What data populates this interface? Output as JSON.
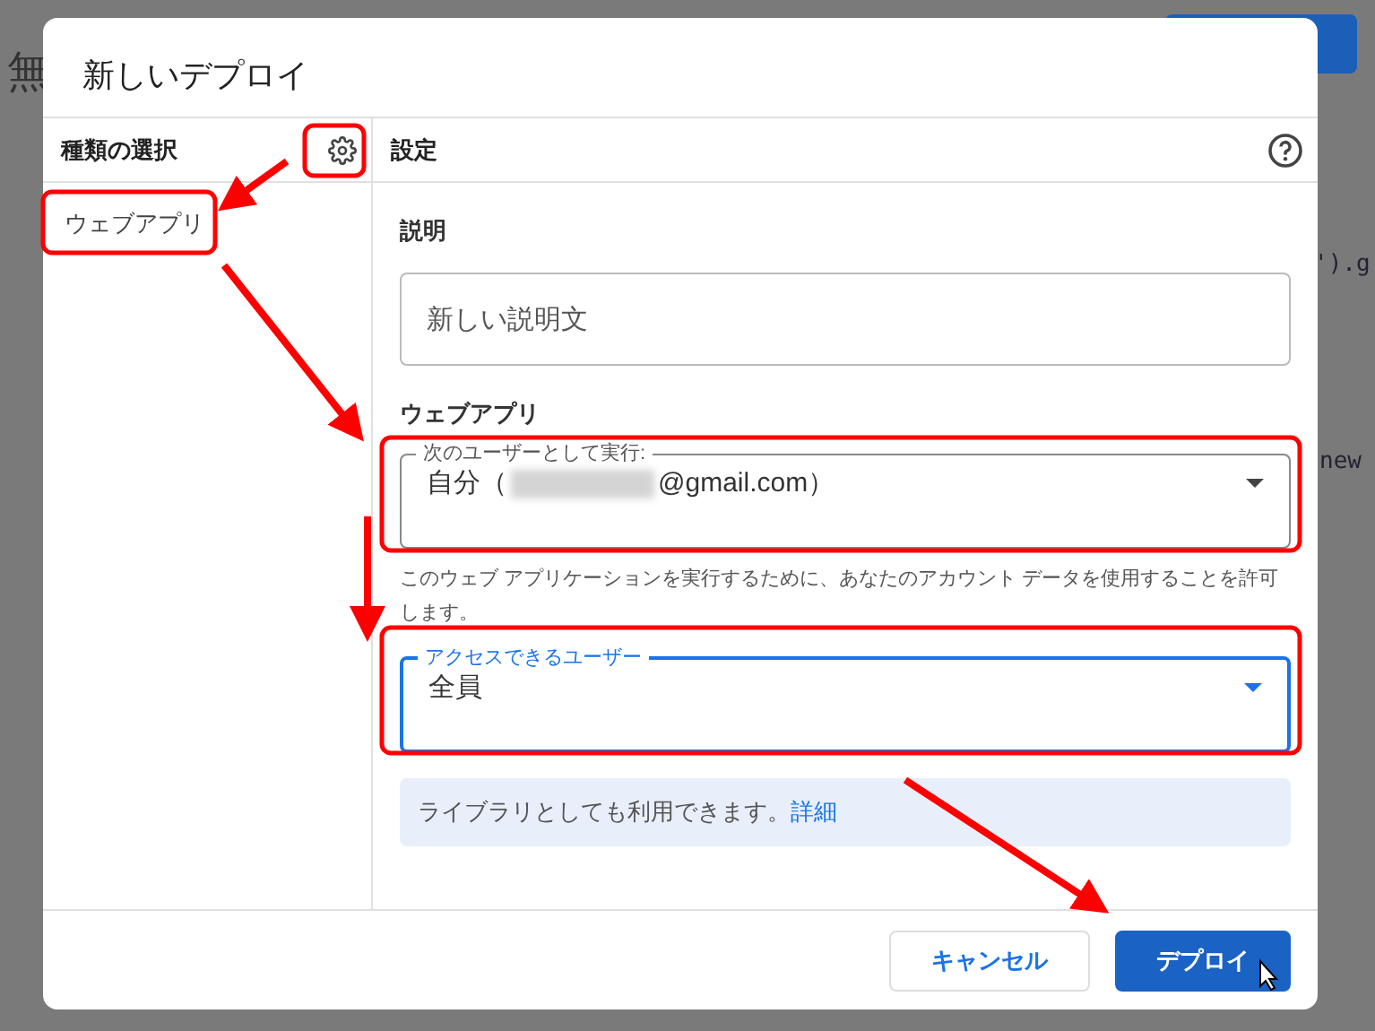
{
  "background": {
    "title": "無",
    "code_lines": [
      "').g",
      "new"
    ]
  },
  "dialog": {
    "title": "新しいデプロイ",
    "sidebar": {
      "heading": "種類の選択",
      "items": [
        {
          "label": "ウェブアプリ"
        }
      ]
    },
    "settings": {
      "heading": "設定",
      "description": {
        "label": "説明",
        "placeholder": "新しい説明文"
      },
      "section": "ウェブアプリ",
      "fields": [
        {
          "label": "次のユーザーとして実行:",
          "value_prefix": "自分（",
          "value_suffix": "@gmail.com）",
          "redacted": true,
          "focused": false
        },
        {
          "label": "アクセスできるユーザー",
          "value_prefix": "全員",
          "focused": true
        }
      ],
      "help": "このウェブ アプリケーションを実行するために、あなたのアカウント データを使用することを許可します。",
      "info": {
        "text": "ライブラリとしても利用できます。",
        "link": "詳細"
      }
    },
    "buttons": [
      {
        "label": "キャンセル",
        "kind": "secondary"
      },
      {
        "label": "デプロイ",
        "kind": "primary"
      }
    ]
  }
}
